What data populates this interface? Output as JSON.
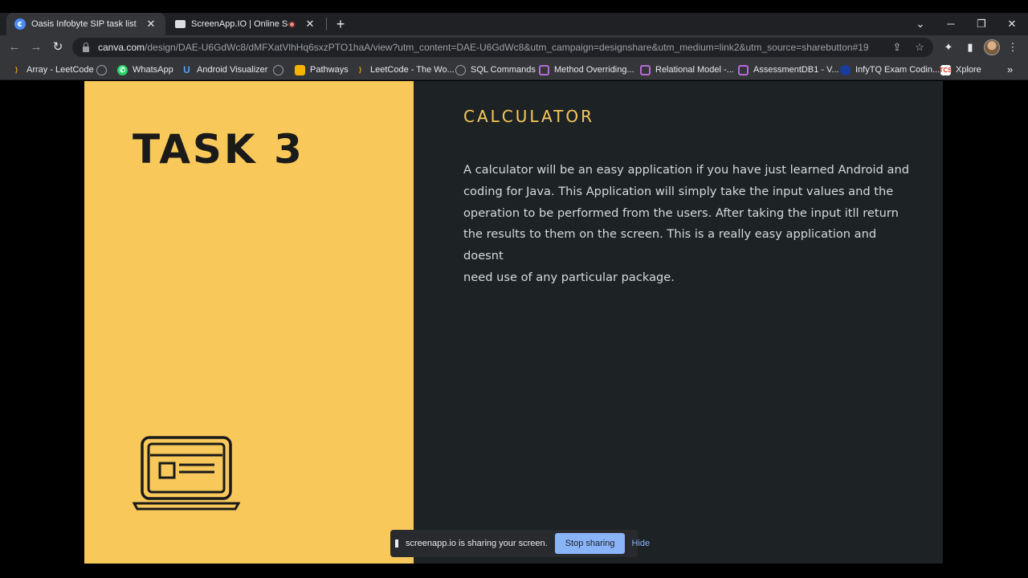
{
  "browser": {
    "tabs": [
      {
        "title": "Oasis Infobyte SIP task list",
        "active": true,
        "favicon": "canva-icon"
      },
      {
        "title": "ScreenApp.IO | Online Screen",
        "active": false,
        "favicon": "screenapp-icon"
      }
    ],
    "new_tab_label": "+",
    "url_host": "canva.com",
    "url_path": "/design/DAE-U6GdWc8/dMFXatVlhHq6sxzPTO1haA/view?utm_content=DAE-U6GdWc8&utm_campaign=designshare&utm_medium=link2&utm_source=sharebutton#19",
    "bookmarks": [
      {
        "label": "Array - LeetCode",
        "icon": "leetcode-icon"
      },
      {
        "label": "",
        "icon": "globe-icon"
      },
      {
        "label": "WhatsApp",
        "icon": "whatsapp-icon"
      },
      {
        "label": "Android Visualizer",
        "icon": "android-visualizer-icon"
      },
      {
        "label": "",
        "icon": "globe-icon"
      },
      {
        "label": "Pathways",
        "icon": "pathways-icon"
      },
      {
        "label": "LeetCode - The Wo...",
        "icon": "leetcode-icon"
      },
      {
        "label": "SQL Commands",
        "icon": "globe-icon"
      },
      {
        "label": "Method Overriding...",
        "icon": "purple-doc-icon"
      },
      {
        "label": "Relational Model -...",
        "icon": "purple-doc-icon"
      },
      {
        "label": "AssessmentDB1 - V...",
        "icon": "purple-doc-icon"
      },
      {
        "label": "InfyTQ Exam Codin...",
        "icon": "infytq-icon"
      },
      {
        "label": "Xplore",
        "icon": "xplore-icon"
      }
    ],
    "colors": {
      "tabstrip": "#202124",
      "toolbar": "#35363a",
      "accent_blue": "#8ab4f8"
    }
  },
  "slide": {
    "task_title": "TASK 3",
    "heading": "CALCULATOR",
    "body_lines": [
      "A calculator will be an easy application if you have just learned Android and",
      "coding for Java. This Application will simply take the input values and the",
      "operation to be performed from the users. After taking the input itll return",
      "the results to them on the screen. This is a really easy application and doesnt",
      "need use of any particular package."
    ],
    "colors": {
      "yellow": "#f8c95a",
      "dark": "#1d2224",
      "heading": "#f8c95a"
    },
    "illustration": "laptop-icon"
  },
  "share_bar": {
    "message": "screenapp.io is sharing your screen.",
    "stop_label": "Stop sharing",
    "hide_label": "Hide"
  }
}
